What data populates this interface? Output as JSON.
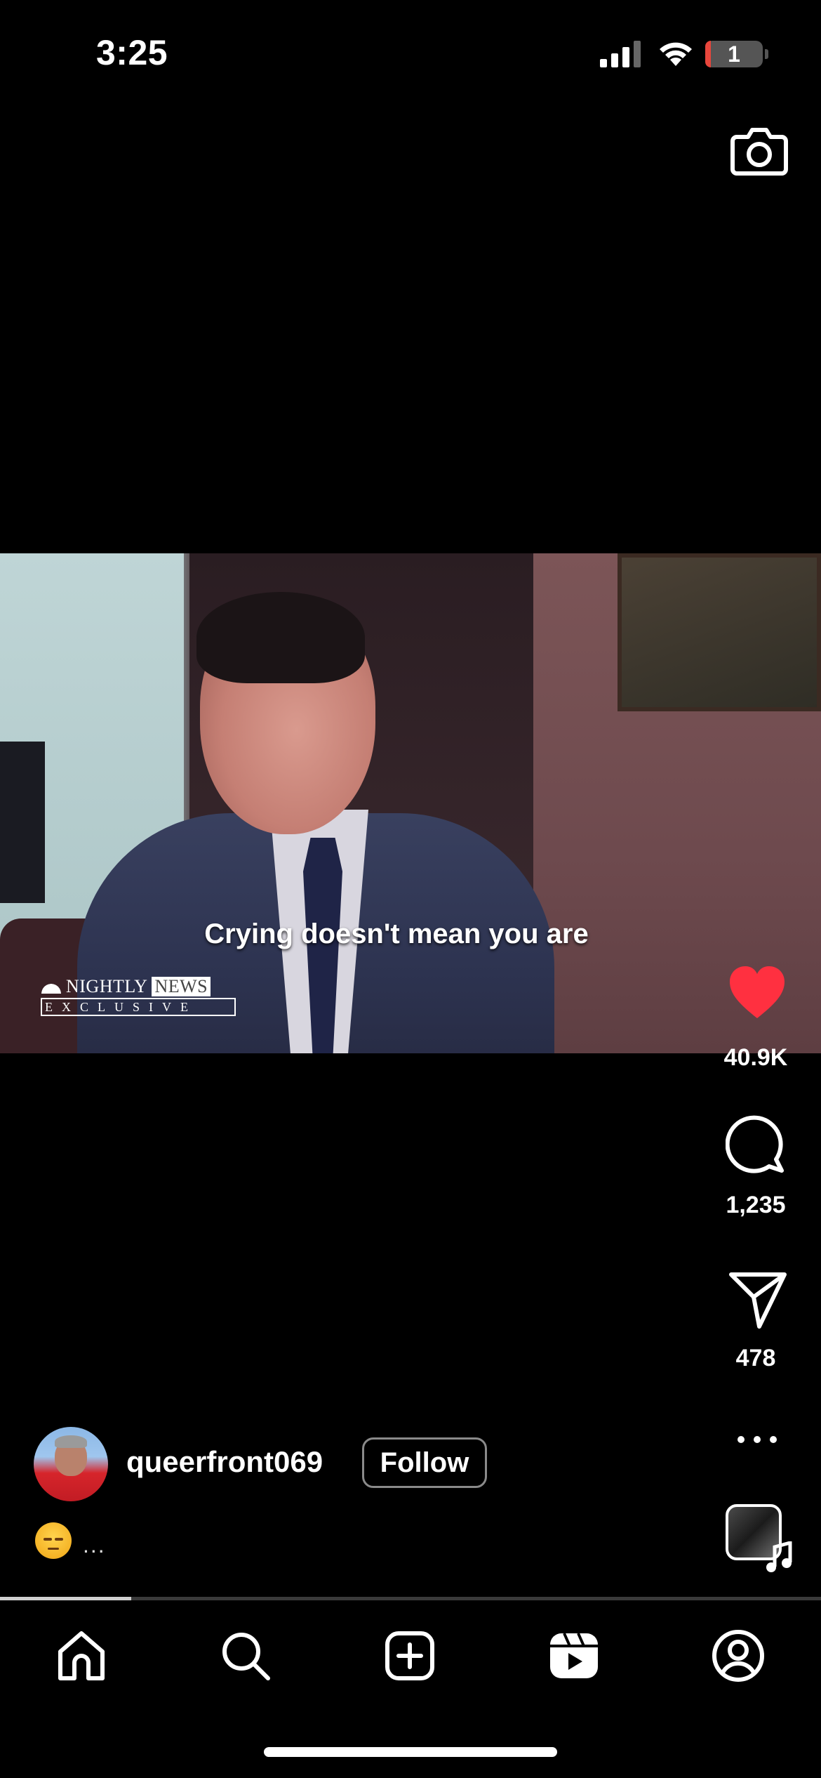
{
  "status_bar": {
    "time": "3:25",
    "battery_level": "1",
    "battery_fill_percent": 10
  },
  "video": {
    "subtitle": "Crying doesn't mean you are",
    "news_logo": {
      "line1_a": "NIGHTLY",
      "line1_b": "NEWS",
      "line2": "EXCLUSIVE"
    },
    "progress_fraction": 0.16
  },
  "actions": {
    "likes": "40.9K",
    "comments": "1,235",
    "shares": "478",
    "liked": true
  },
  "author": {
    "username": "queerfront069",
    "follow_label": "Follow"
  },
  "caption": {
    "more": "..."
  },
  "tabs": [
    "home-icon",
    "search-icon",
    "create-icon",
    "reels-icon",
    "profile-icon"
  ],
  "colors": {
    "background": "#000000",
    "like": "#ff3040",
    "battery_low": "#e8463c"
  }
}
